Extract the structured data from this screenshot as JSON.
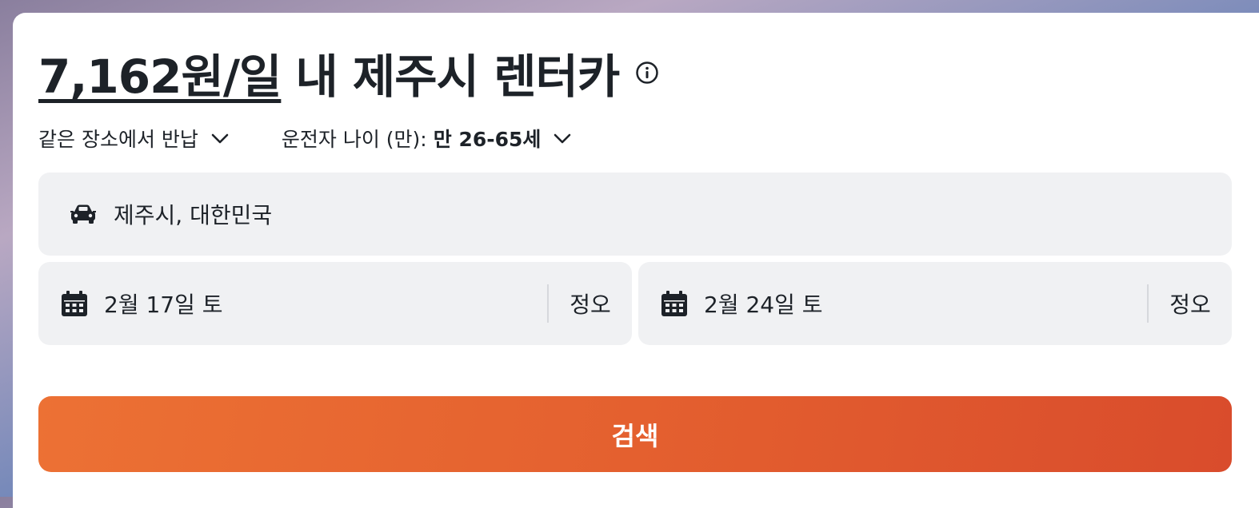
{
  "header": {
    "price": "7,162원/일",
    "title_rest": "내 제주시 렌터카"
  },
  "options": {
    "return_label": "같은 장소에서 반납",
    "driver_age_label": "운전자 나이 (만):",
    "driver_age_value": "만 26-65세"
  },
  "location": {
    "value": "제주시, 대한민국"
  },
  "pickup": {
    "date": "2월 17일 토",
    "time": "정오"
  },
  "dropoff": {
    "date": "2월 24일 토",
    "time": "정오"
  },
  "search_button": {
    "label": "검색"
  },
  "icons": [
    "info-icon",
    "chevron-down-icon",
    "car-icon",
    "calendar-icon"
  ],
  "colors": {
    "accent_start": "#ec7134",
    "accent_end": "#d94c2c",
    "field_bg": "#f0f1f3",
    "text": "#1d2228"
  }
}
